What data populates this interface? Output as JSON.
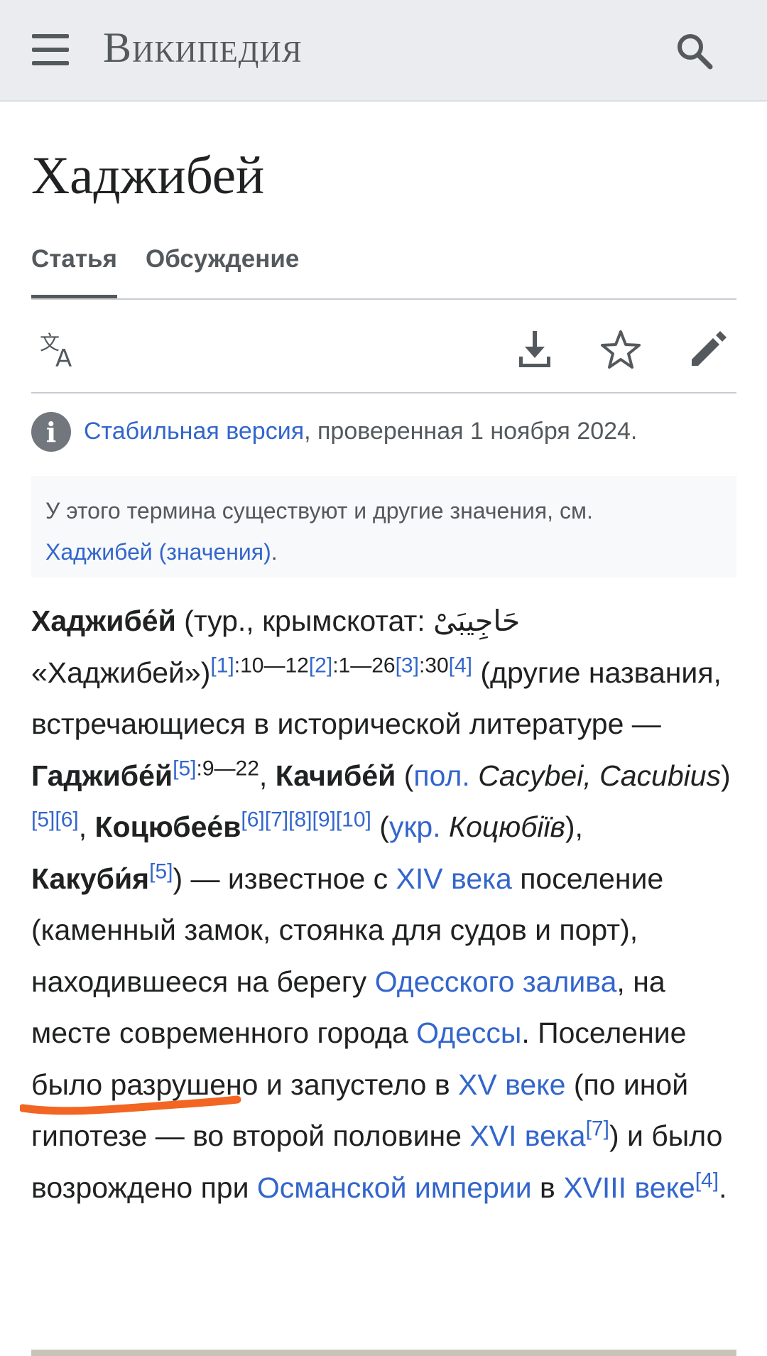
{
  "header": {
    "wordmark": "Википедия",
    "menu_icon": "hamburger-menu-icon",
    "search_icon": "search-icon"
  },
  "page": {
    "title": "Хаджибей"
  },
  "tabs": [
    {
      "label": "Статья",
      "active": true
    },
    {
      "label": "Обсуждение",
      "active": false
    }
  ],
  "toolbar": {
    "icons": [
      "language-icon",
      "download-icon",
      "star-icon",
      "edit-icon"
    ]
  },
  "stable_notice": {
    "link": "Стабильная версия",
    "text": ", проверенная 1 ноября 2024."
  },
  "hatnote": {
    "text": "У этого термина существуют и другие значения, см.",
    "link": "Хаджибей (значения)",
    "end": "."
  },
  "article": {
    "l1_bold": "Хаджибе́й",
    "l1_text": " (тур., крымскотат: ",
    "l1_arabic": "حَاجِيبَىْ",
    "l2_text": "«Хаджибей»)",
    "ref1": "[1]",
    "p1": ":10—12",
    "ref2": "[2]",
    "p2": ":1—26",
    "ref3": "[3]",
    "p3": ":30",
    "ref4": "[4]",
    "l2_end": " (другие названия, встречающиеся в исторической литературе — ",
    "name_gadz": "Гаджибе́й",
    "ref5": "[5]",
    "p5": ":9—22",
    "comma1": ", ",
    "name_kach": "Качибе́й",
    "open_par": " (",
    "pol": "пол.",
    "latin": " Cacybei, Cacubius",
    "close_par": ")",
    "ref5b": "[5]",
    "ref6": "[6]",
    "comma2": ", ",
    "name_kots": "Коцюбее́в",
    "ref6b": "[6]",
    "ref7": "[7]",
    "ref8": "[8]",
    "ref9": "[9]",
    "ref10": "[10]",
    "open_par2": " (",
    "ukr": "укр.",
    "ukr_name": " Коцюбіїв",
    "close_par2": "), ",
    "name_kak": "Какуби́я",
    "ref5c": "[5]",
    "text_after": ") — известное с ",
    "xiv": "XIV века",
    "text2": " поселение (каменный замок, стоянка для судов и порт), находившееся на берегу ",
    "odessa_bay": "Одесского залива",
    "text3": ", на месте современного города ",
    "odessa": "Одессы",
    "text4": ". Поселение было разрушено и запустело в ",
    "xv": "XV веке",
    "text5": " (по иной гипотезе — во второй половине ",
    "xvi": "XVI века",
    "ref7b": "[7]",
    "text6": ") и было возрождено при ",
    "ottoman": "Османской империи",
    "text7": " в ",
    "xviii": "XVIII веке",
    "ref4b": "[4]",
    "text8": "."
  },
  "colors": {
    "link": "#3366cc",
    "header_bg": "#eaecf0",
    "annotation": "#f26522"
  }
}
